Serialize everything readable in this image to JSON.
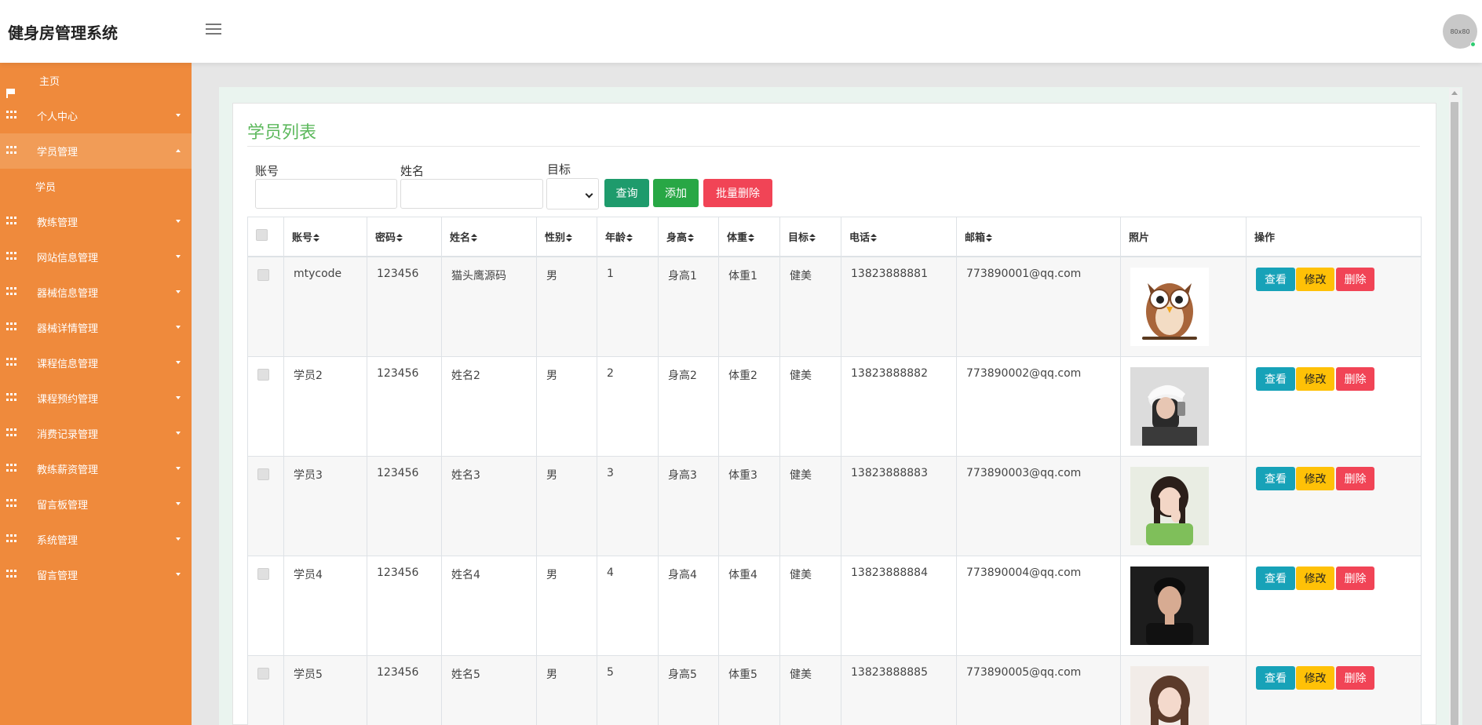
{
  "app": {
    "title": "健身房管理系统",
    "avatar_text": "80x80"
  },
  "sidebar": {
    "items": [
      {
        "label": "主页",
        "icon": "flag-icon"
      },
      {
        "label": "个人中心",
        "icon": "grid-icon"
      },
      {
        "label": "学员管理",
        "icon": "grid-icon",
        "expanded": true,
        "children": [
          "学员"
        ]
      },
      {
        "label": "教练管理",
        "icon": "grid-icon"
      },
      {
        "label": "网站信息管理",
        "icon": "grid-icon"
      },
      {
        "label": "器械信息管理",
        "icon": "grid-icon"
      },
      {
        "label": "器械详情管理",
        "icon": "grid-icon"
      },
      {
        "label": "课程信息管理",
        "icon": "grid-icon"
      },
      {
        "label": "课程预约管理",
        "icon": "grid-icon"
      },
      {
        "label": "消费记录管理",
        "icon": "grid-icon"
      },
      {
        "label": "教练薪资管理",
        "icon": "grid-icon"
      },
      {
        "label": "留言板管理",
        "icon": "grid-icon"
      },
      {
        "label": "系统管理",
        "icon": "grid-icon"
      },
      {
        "label": "留言管理",
        "icon": "grid-icon"
      }
    ]
  },
  "page": {
    "title": "学员列表"
  },
  "search": {
    "account_label": "账号",
    "account_value": "",
    "name_label": "姓名",
    "name_value": "",
    "goal_label": "目标",
    "goal_value": ""
  },
  "buttons": {
    "query": "查询",
    "add": "添加",
    "batch_delete": "批量删除"
  },
  "table": {
    "columns": [
      "账号",
      "密码",
      "姓名",
      "性别",
      "年龄",
      "身高",
      "体重",
      "目标",
      "电话",
      "邮箱",
      "照片",
      "操作"
    ],
    "rows": [
      {
        "account": "mtycode",
        "password": "123456",
        "name": "猫头鹰源码",
        "gender": "男",
        "age": "1",
        "height": "身高1",
        "weight": "体重1",
        "goal": "健美",
        "phone": "13823888881",
        "email": "773890001@qq.com",
        "photo": "owl-photo"
      },
      {
        "account": "学员2",
        "password": "123456",
        "name": "姓名2",
        "gender": "男",
        "age": "2",
        "height": "身高2",
        "weight": "体重2",
        "goal": "健美",
        "phone": "13823888882",
        "email": "773890002@qq.com",
        "photo": "selfie-photo"
      },
      {
        "account": "学员3",
        "password": "123456",
        "name": "姓名3",
        "gender": "男",
        "age": "3",
        "height": "身高3",
        "weight": "体重3",
        "goal": "健美",
        "phone": "13823888883",
        "email": "773890003@qq.com",
        "photo": "girl-photo"
      },
      {
        "account": "学员4",
        "password": "123456",
        "name": "姓名4",
        "gender": "男",
        "age": "4",
        "height": "身高4",
        "weight": "体重4",
        "goal": "健美",
        "phone": "13823888884",
        "email": "773890004@qq.com",
        "photo": "boy-photo"
      },
      {
        "account": "学员5",
        "password": "123456",
        "name": "姓名5",
        "gender": "男",
        "age": "5",
        "height": "身高5",
        "weight": "体重5",
        "goal": "健美",
        "phone": "13823888885",
        "email": "773890005@qq.com",
        "photo": "woman-photo"
      }
    ],
    "actions": {
      "view": "查看",
      "edit": "修改",
      "delete": "删除"
    }
  },
  "colors": {
    "sidebar_bg": "#ef8a3c",
    "title_green": "#5cb85c",
    "view_btn": "#17a2b8",
    "edit_btn": "#ffc107",
    "delete_btn": "#f14456",
    "add_btn": "#28a745",
    "query_btn": "#1e9b6c"
  }
}
